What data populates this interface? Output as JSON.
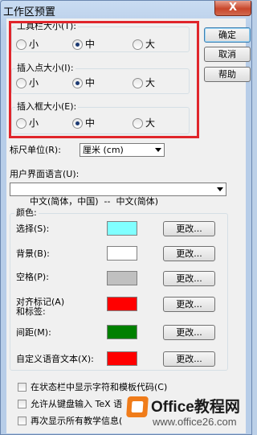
{
  "window": {
    "title": "工作区预置",
    "close_glyph": "X"
  },
  "groups": {
    "toolbar_size": {
      "label": "工具栏大小(T):",
      "options": [
        "小",
        "中",
        "大"
      ],
      "selected": "中"
    },
    "insertion_point_size": {
      "label": "插入点大小(I):",
      "options": [
        "小",
        "中",
        "大"
      ],
      "selected": "中"
    },
    "insertion_frame_size": {
      "label": "插入框大小(E):",
      "options": [
        "小",
        "中",
        "大"
      ],
      "selected": "中"
    }
  },
  "buttons": {
    "ok": "确定",
    "cancel": "取消",
    "help": "帮助"
  },
  "ruler": {
    "label": "标尺单位(R):",
    "value": "厘米 (cm)"
  },
  "ui_language": {
    "label": "用户界面语言(U):",
    "value": "中文(简体，中国)  --  中文(简体)"
  },
  "colors": {
    "group_label": "颜色:",
    "change_label": "更改...",
    "items": [
      {
        "label": "选择(S):",
        "color": "#80ffff"
      },
      {
        "label": "背景(B):",
        "color": "#ffffff"
      },
      {
        "label": "空格(P):",
        "color": "#c0c0c0"
      },
      {
        "label": "对齐标记(A)\n和标签:",
        "color": "#ff0000"
      },
      {
        "label": "间距(M):",
        "color": "#008000"
      },
      {
        "label": "自定义语音文本(X):",
        "color": "#ff0000"
      }
    ]
  },
  "checkboxes": [
    {
      "label": "在状态栏中显示字符和模板代码(C)",
      "checked": false
    },
    {
      "label": "允许从键盘输入 TeX 语",
      "checked": false
    },
    {
      "label": "再次显示所有教学信息(",
      "checked": false
    }
  ],
  "watermark": {
    "brand": "Office教程网",
    "url": "www.office26.com",
    "brand_color": "#f07c1a"
  }
}
